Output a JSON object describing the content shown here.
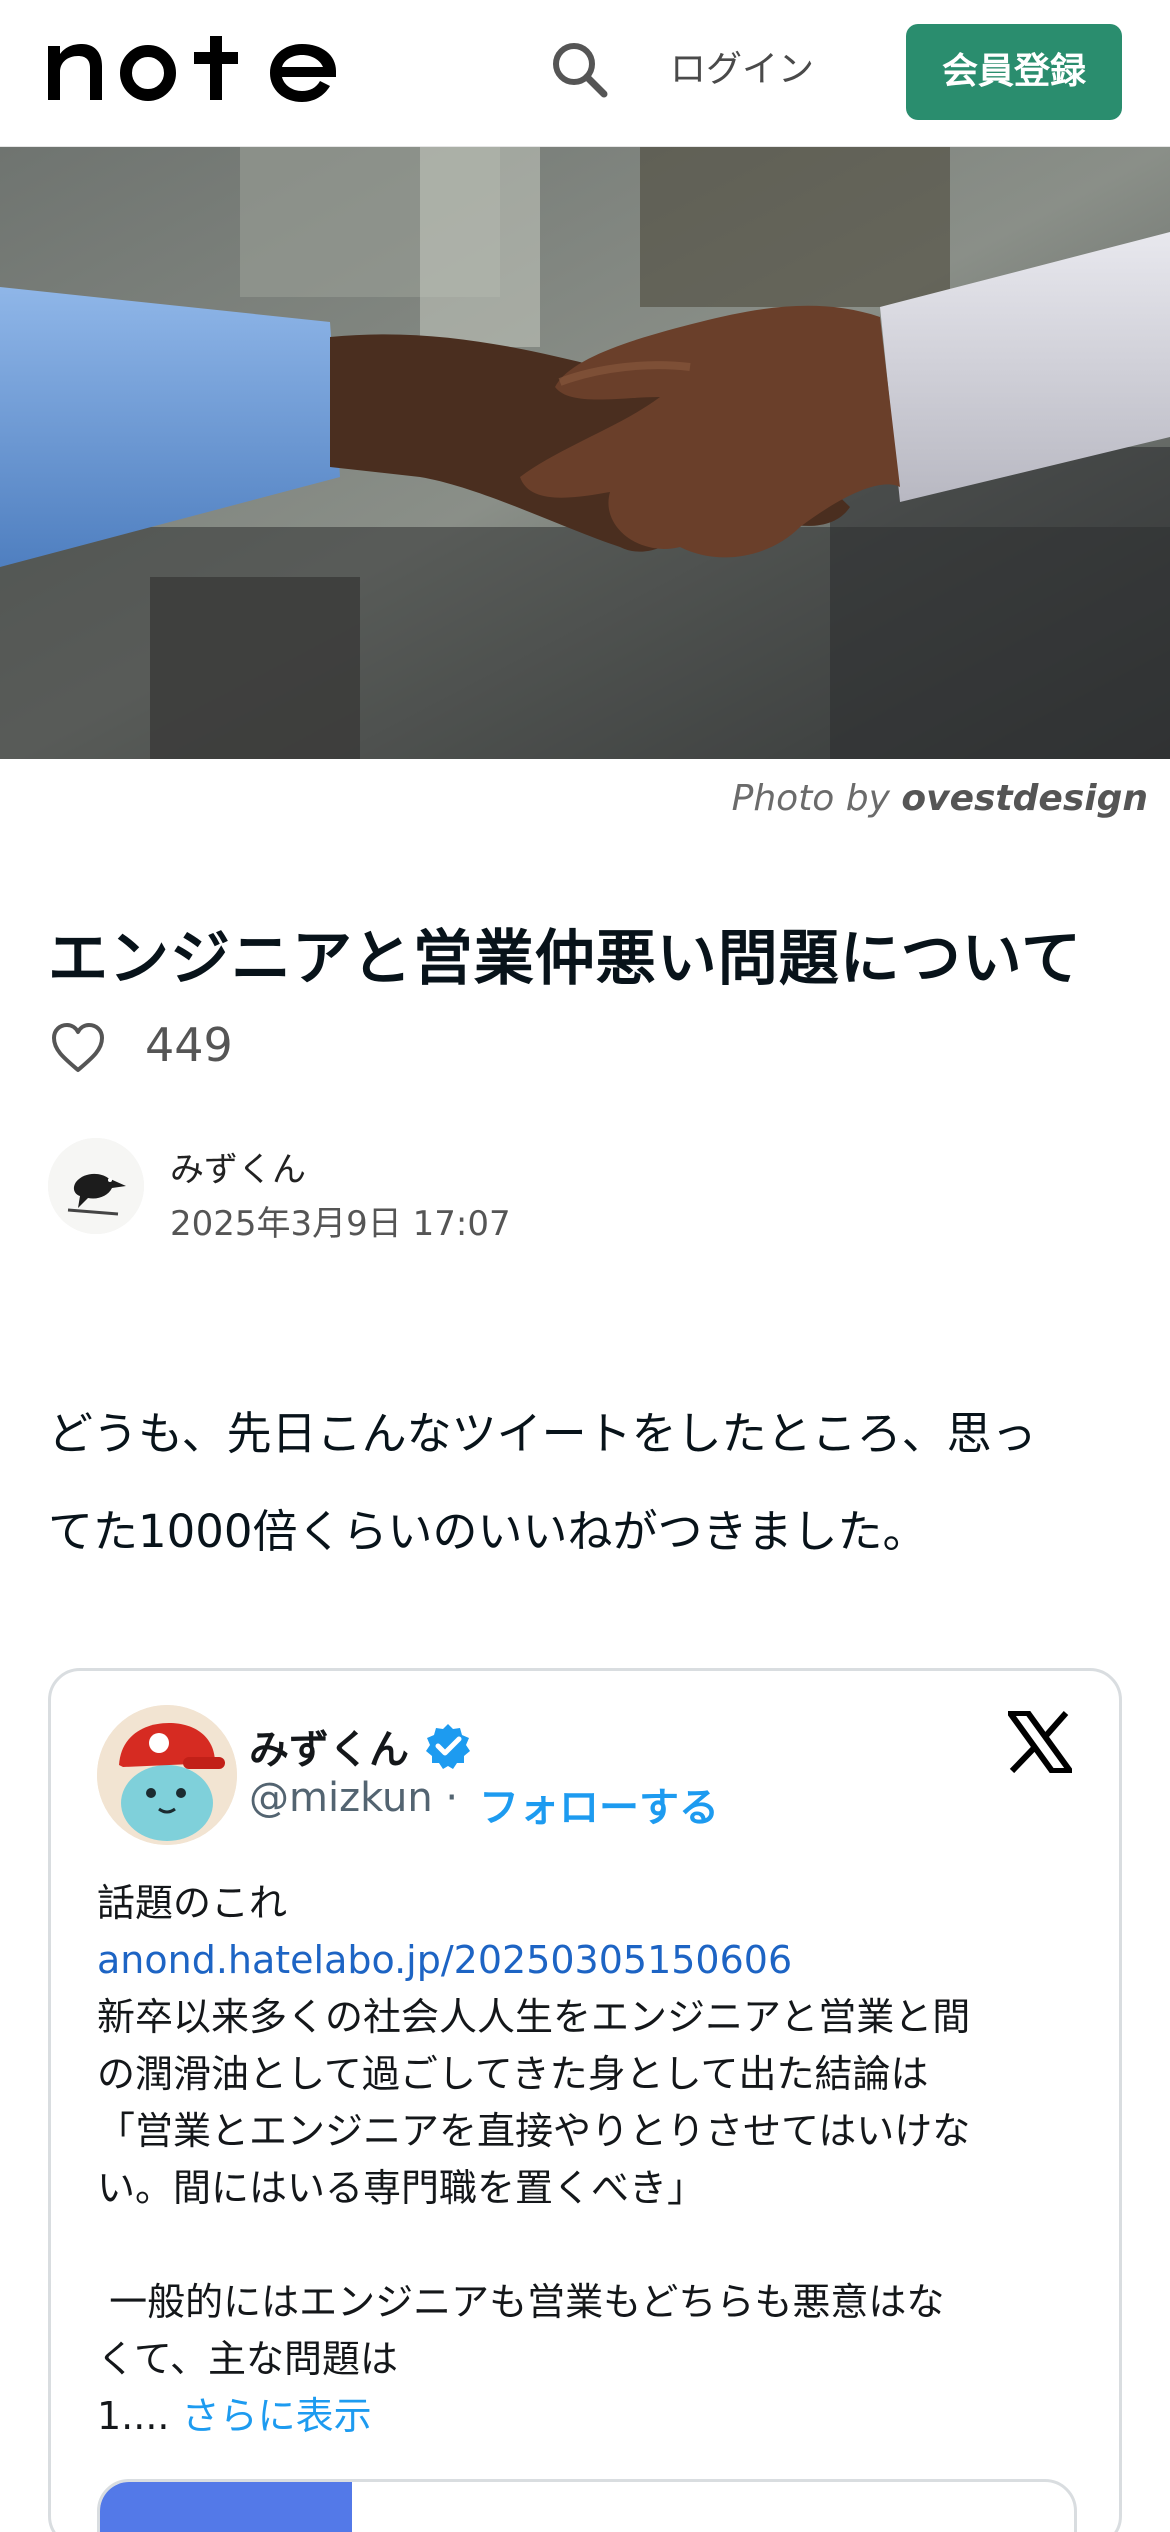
{
  "header": {
    "logo_alt": "note",
    "login_label": "ログイン",
    "signup_label": "会員登録"
  },
  "hero": {
    "credit_prefix": "Photo by",
    "credit_author": "ovestdesign"
  },
  "article": {
    "title": "エンジニアと営業仲悪い問題について",
    "like_count": "449",
    "author_name": "みずくん",
    "date": "2025年3月9日 17:07",
    "body_line1": "どうも、先日こんなツイートをしたところ、思っ",
    "body_line2": "てた1000倍くらいのいいねがつきました。"
  },
  "tweet": {
    "name": "みずくん",
    "handle": "@mizkun",
    "separator": " · ",
    "follow_label": "フォローする",
    "line1": "話題のこれ",
    "link": "anond.hatelabo.jp/20250305150606",
    "line2": "新卒以来多くの社会人人生をエンジニアと営業と間",
    "line3": "の潤滑油として過ごしてきた身として出た結論は",
    "line4": "「営業とエンジニアを直接やりとりさせてはいけな",
    "line5": "い。間にはいる専門職を置くべき」",
    "line6": " 一般的にはエンジニアも営業もどちらも悪意はな",
    "line7": "くて、主な問題は",
    "line8": "1....",
    "more_label": "さらに表示"
  },
  "colors": {
    "brand_green": "#2a8d6e",
    "link_blue": "#1d9bf0",
    "text_dark": "#08131a"
  },
  "icons": {
    "search": "search-icon",
    "like": "heart-outline-icon",
    "verified": "verified-badge-icon",
    "x": "x-logo-icon"
  }
}
